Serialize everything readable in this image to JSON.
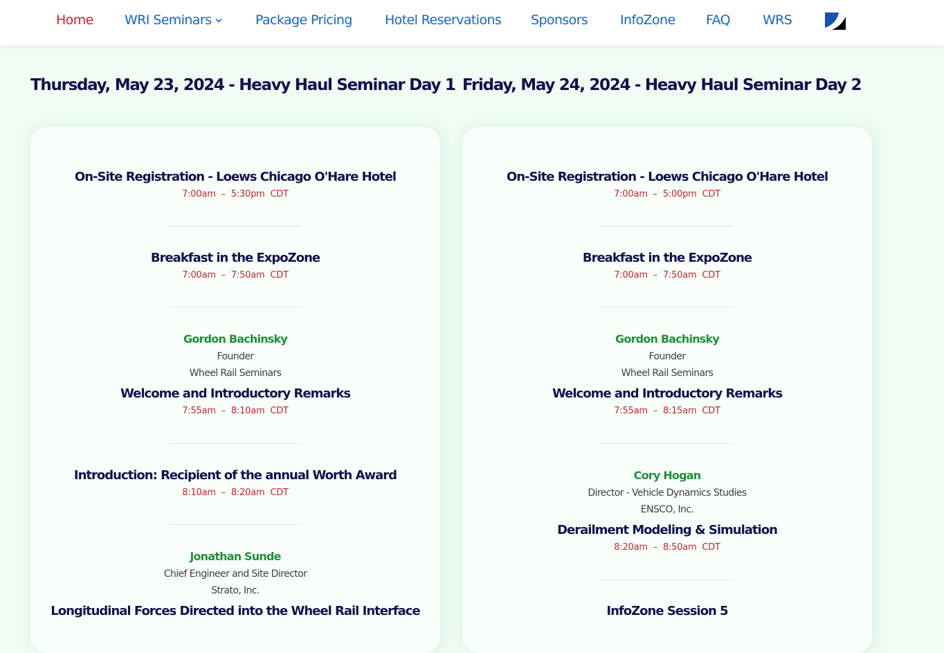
{
  "nav": {
    "items": [
      {
        "label": "Home",
        "active": true
      },
      {
        "label": "WRI Seminars",
        "has_dropdown": true
      },
      {
        "label": "Package Pricing"
      },
      {
        "label": "Hotel Reservations"
      },
      {
        "label": "Sponsors"
      },
      {
        "label": "InfoZone"
      },
      {
        "label": "FAQ"
      },
      {
        "label": "WRS"
      }
    ],
    "logo_icon": "wrs-logo-icon"
  },
  "colors": {
    "background": "#effdf4",
    "nav_link": "#1565d0",
    "nav_active": "#c9242f",
    "heading": "#12104e",
    "time": "#c9242f",
    "speaker": "#1f8f3a"
  },
  "days": [
    {
      "title": "Thursday, May 23, 2024 - Heavy Haul Seminar Day 1",
      "sessions": [
        {
          "title": "On-Site Registration - Loews Chicago O'Hare Hotel",
          "start": "7:00am",
          "end": "5:30pm",
          "tz": "CDT"
        },
        {
          "title": "Breakfast in the ExpoZone",
          "start": "7:00am",
          "end": "7:50am",
          "tz": "CDT"
        },
        {
          "speaker": "Gordon Bachinsky",
          "role": "Founder",
          "org": "Wheel Rail Seminars",
          "title": "Welcome and Introductory Remarks",
          "start": "7:55am",
          "end": "8:10am",
          "tz": "CDT"
        },
        {
          "title": "Introduction: Recipient of the annual Worth Award",
          "start": "8:10am",
          "end": "8:20am",
          "tz": "CDT"
        },
        {
          "speaker": "Jonathan Sunde",
          "role": "Chief Engineer and Site Director",
          "org": "Strato, Inc.",
          "title": "Longitudinal Forces Directed into the Wheel Rail Interface"
        }
      ]
    },
    {
      "title": "Friday, May 24, 2024 - Heavy Haul Seminar Day 2",
      "sessions": [
        {
          "title": "On-Site Registration - Loews Chicago O'Hare Hotel",
          "start": "7:00am",
          "end": "5:00pm",
          "tz": "CDT"
        },
        {
          "title": "Breakfast in the ExpoZone",
          "start": "7:00am",
          "end": "7:50am",
          "tz": "CDT"
        },
        {
          "speaker": "Gordon Bachinsky",
          "role": "Founder",
          "org": "Wheel Rail Seminars",
          "title": "Welcome and Introductory Remarks",
          "start": "7:55am",
          "end": "8:15am",
          "tz": "CDT"
        },
        {
          "speaker": "Cory Hogan",
          "role": "Director - Vehicle Dynamics Studies",
          "org": "ENSCO, Inc.",
          "title": "Derailment Modeling & Simulation",
          "start": "8:20am",
          "end": "8:50am",
          "tz": "CDT"
        },
        {
          "title": "InfoZone Session 5"
        }
      ]
    }
  ]
}
